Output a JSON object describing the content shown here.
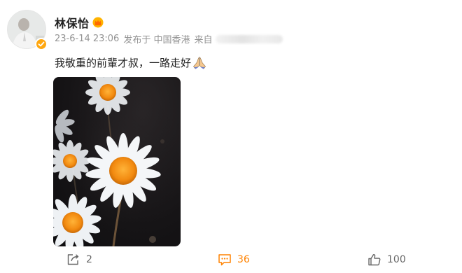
{
  "post": {
    "username": "林保怡",
    "date": "23-6-14 23:06",
    "published_from": "发布于 中国香港",
    "source_label": "来自",
    "text": "我敬重的前輩才叔，一路走好"
  },
  "actions": {
    "repost_count": "2",
    "comment_count": "36",
    "like_count": "100"
  },
  "colors": {
    "accent_orange": "#ff8200",
    "verified_badge": "#ffa70f",
    "meta_gray": "#939393"
  },
  "icons": [
    "verified-badge-icon",
    "crown-vip-icon",
    "praying-hands-emoji",
    "repost-icon",
    "comment-icon",
    "like-icon"
  ]
}
